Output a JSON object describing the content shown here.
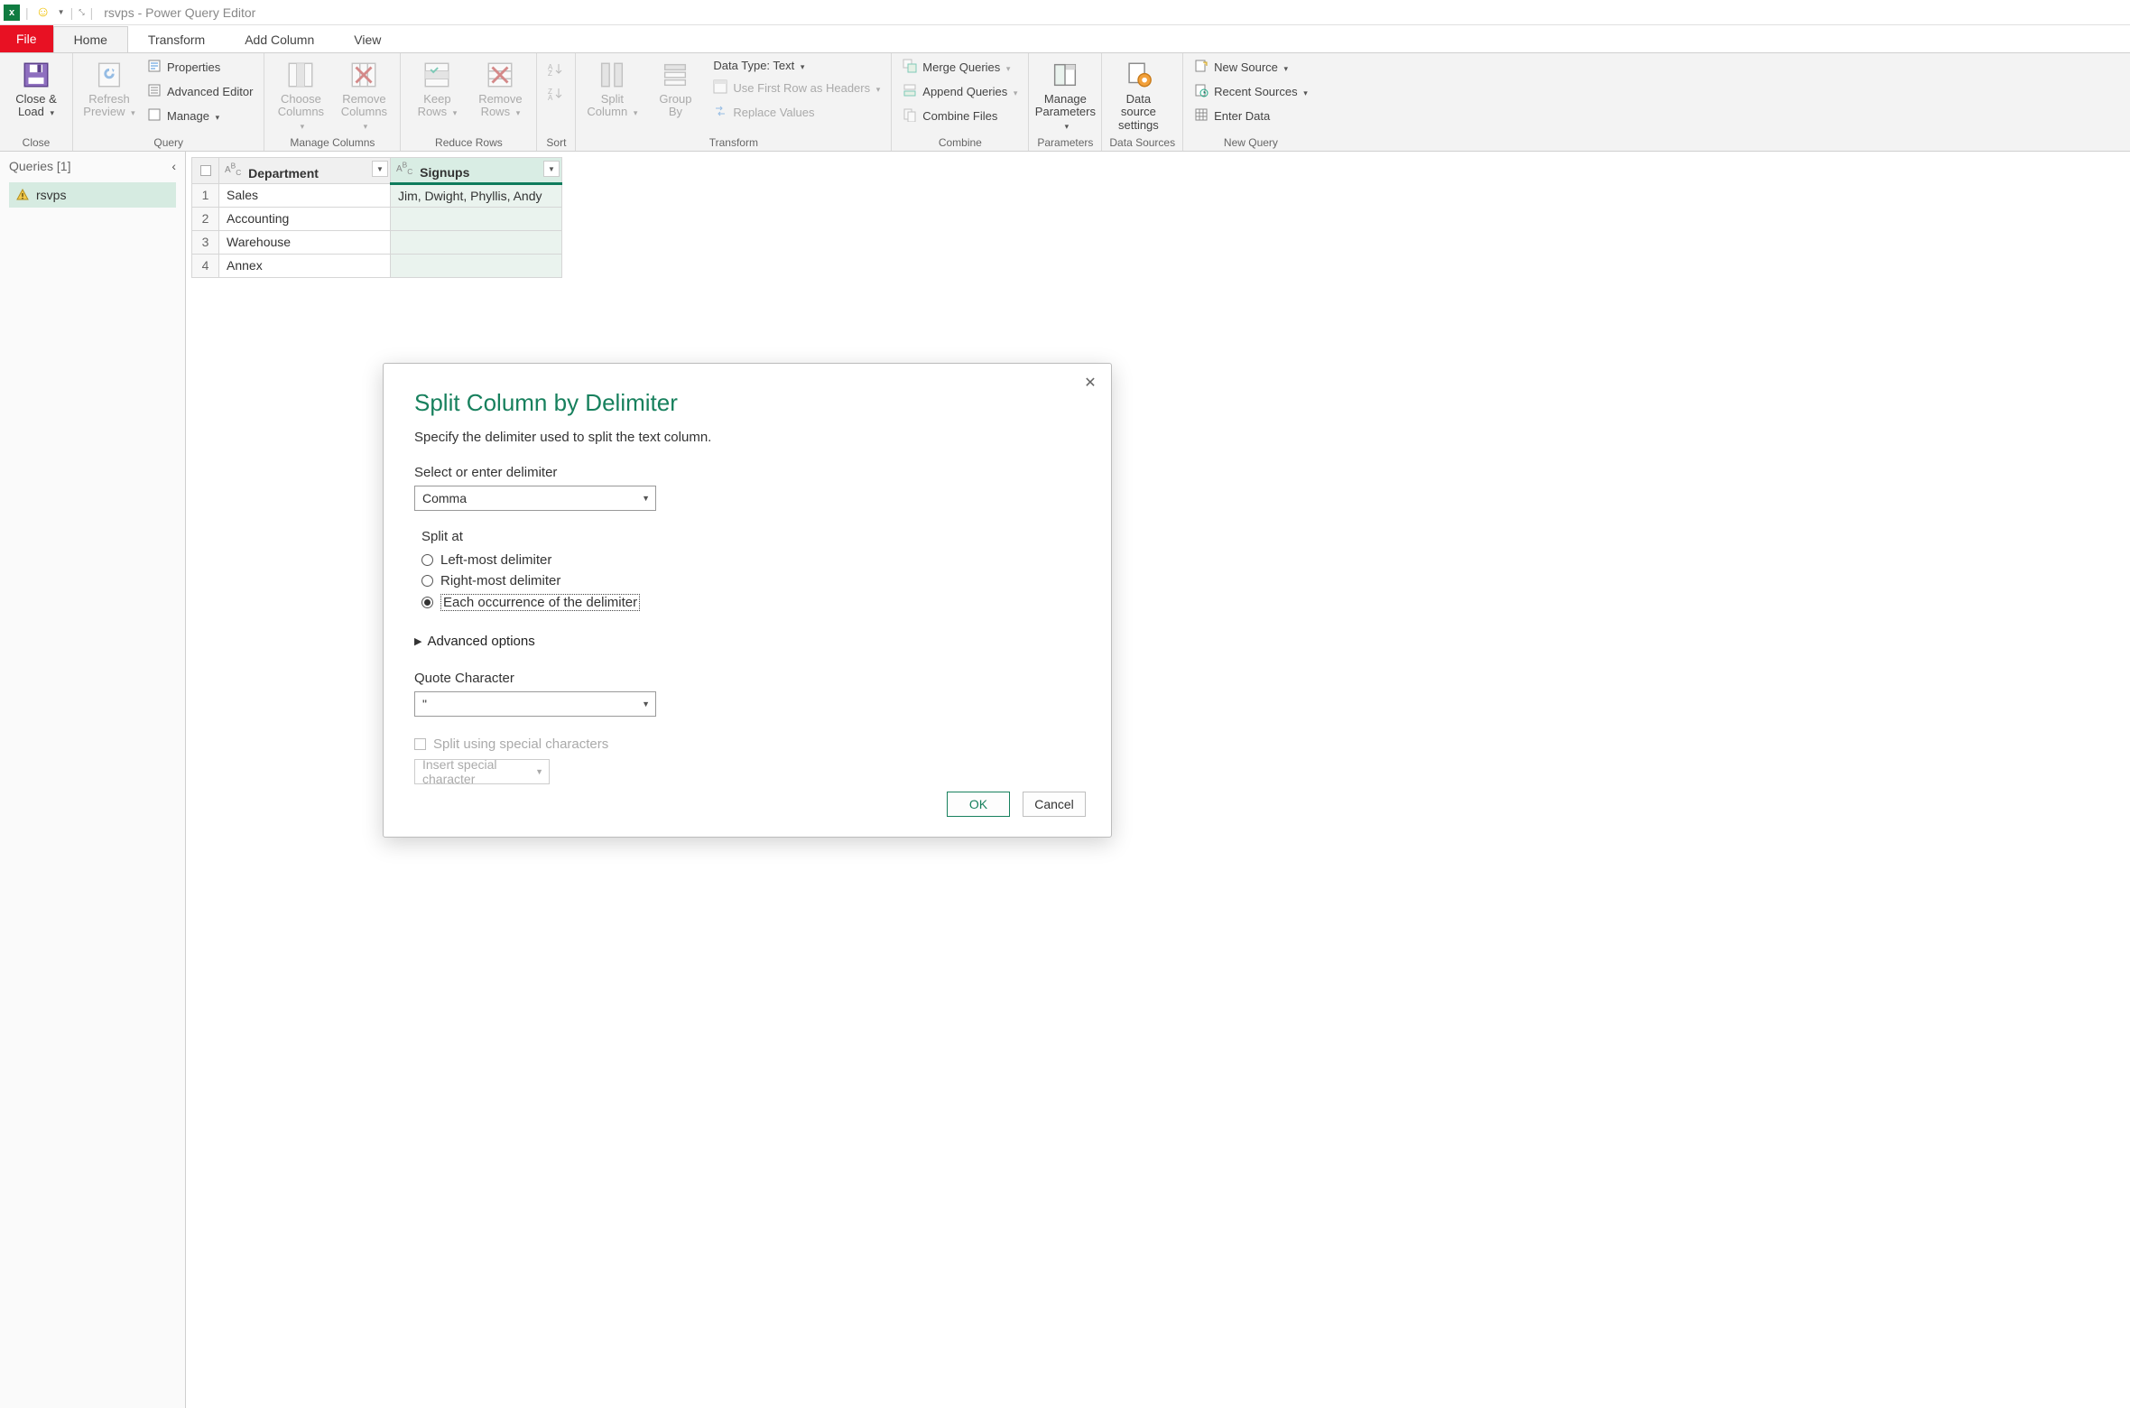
{
  "titlebar": {
    "title": "rsvps - Power Query Editor"
  },
  "tabs": {
    "file": "File",
    "home": "Home",
    "transform": "Transform",
    "addcolumn": "Add Column",
    "view": "View"
  },
  "ribbon": {
    "close": {
      "close_load": "Close &\nLoad",
      "group": "Close"
    },
    "query": {
      "refresh": "Refresh\nPreview",
      "properties": "Properties",
      "adv_editor": "Advanced Editor",
      "manage": "Manage",
      "group": "Query"
    },
    "mcols": {
      "choose": "Choose\nColumns",
      "remove": "Remove\nColumns",
      "group": "Manage Columns"
    },
    "rrows": {
      "keep": "Keep\nRows",
      "remove": "Remove\nRows",
      "group": "Reduce Rows"
    },
    "sort": {
      "group": "Sort"
    },
    "transform": {
      "split": "Split\nColumn",
      "groupby": "Group\nBy",
      "datatype": "Data Type: Text",
      "firstrow": "Use First Row as Headers",
      "replace": "Replace Values",
      "group": "Transform"
    },
    "combine": {
      "merge": "Merge Queries",
      "append": "Append Queries",
      "files": "Combine Files",
      "group": "Combine"
    },
    "params": {
      "manage": "Manage\nParameters",
      "group": "Parameters"
    },
    "ds": {
      "settings": "Data source\nsettings",
      "group": "Data Sources"
    },
    "newq": {
      "newsource": "New Source",
      "recent": "Recent Sources",
      "enter": "Enter Data",
      "group": "New Query"
    }
  },
  "sidebar": {
    "title": "Queries [1]",
    "items": [
      {
        "name": "rsvps"
      }
    ]
  },
  "grid": {
    "columns": [
      "Department",
      "Signups"
    ],
    "rows": [
      [
        "Sales",
        "Jim, Dwight, Phyllis, Andy"
      ],
      [
        "Accounting",
        ""
      ],
      [
        "Warehouse",
        ""
      ],
      [
        "Annex",
        ""
      ]
    ]
  },
  "dialog": {
    "title": "Split Column by Delimiter",
    "subtitle": "Specify the delimiter used to split the text column.",
    "delim_label": "Select or enter delimiter",
    "delim_value": "Comma",
    "splitat_label": "Split at",
    "opt_left": "Left-most delimiter",
    "opt_right": "Right-most delimiter",
    "opt_each": "Each occurrence of the delimiter",
    "advanced": "Advanced options",
    "quote_label": "Quote Character",
    "quote_value": "\"",
    "special_check": "Split using special characters",
    "insert_special": "Insert special character",
    "ok": "OK",
    "cancel": "Cancel"
  }
}
